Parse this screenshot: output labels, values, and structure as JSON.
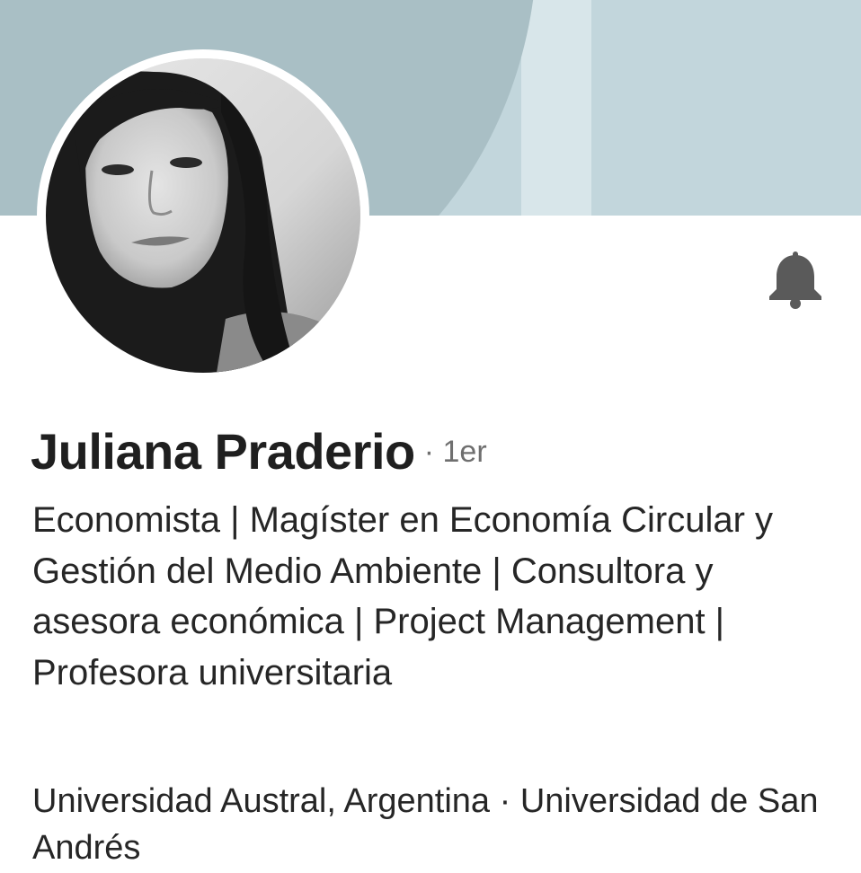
{
  "profile": {
    "name": "Juliana Praderio",
    "degree": "· 1er",
    "headline": "Economista | Magíster en Economía Circular y Gestión del Medio Ambiente | Consultora y asesora económica | Project Management | Profesora universitaria",
    "education": "Universidad Austral, Argentina · Universidad de San Andrés"
  },
  "icons": {
    "notification": "bell-icon",
    "avatar": "profile-photo"
  },
  "colors": {
    "banner_light": "#c2d6dc",
    "banner_strip": "#d8e6ea",
    "banner_arc": "#a9bfc5",
    "text_primary": "#1f1f1f",
    "text_secondary": "#6f6f6f",
    "icon": "#5a5a5a"
  }
}
